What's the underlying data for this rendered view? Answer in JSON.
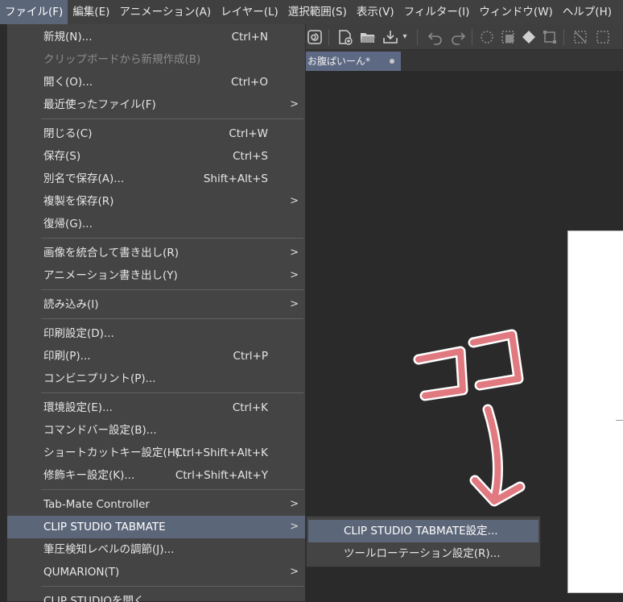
{
  "menubar": {
    "items": [
      {
        "label": "ファイル(F)"
      },
      {
        "label": "編集(E)"
      },
      {
        "label": "アニメーション(A)"
      },
      {
        "label": "レイヤー(L)"
      },
      {
        "label": "選択範囲(S)"
      },
      {
        "label": "表示(V)"
      },
      {
        "label": "フィルター(I)"
      },
      {
        "label": "ウィンドウ(W)"
      },
      {
        "label": "ヘルプ(H)"
      }
    ]
  },
  "document_tab": {
    "title": "お腹ぱいーん*"
  },
  "file_menu": {
    "items": [
      {
        "label": "新規(N)...",
        "shortcut": "Ctrl+N"
      },
      {
        "label": "クリップボードから新規作成(B)",
        "shortcut": ""
      },
      {
        "label": "開く(O)...",
        "shortcut": "Ctrl+O"
      },
      {
        "label": "最近使ったファイル(F)",
        "shortcut": ""
      },
      {
        "label": "閉じる(C)",
        "shortcut": "Ctrl+W"
      },
      {
        "label": "保存(S)",
        "shortcut": "Ctrl+S"
      },
      {
        "label": "別名で保存(A)...",
        "shortcut": "Shift+Alt+S"
      },
      {
        "label": "複製を保存(R)",
        "shortcut": ""
      },
      {
        "label": "復帰(G)...",
        "shortcut": ""
      },
      {
        "label": "画像を統合して書き出し(R)",
        "shortcut": ""
      },
      {
        "label": "アニメーション書き出し(Y)",
        "shortcut": ""
      },
      {
        "label": "読み込み(I)",
        "shortcut": ""
      },
      {
        "label": "印刷設定(D)...",
        "shortcut": ""
      },
      {
        "label": "印刷(P)...",
        "shortcut": "Ctrl+P"
      },
      {
        "label": "コンビニプリント(P)...",
        "shortcut": ""
      },
      {
        "label": "環境設定(E)...",
        "shortcut": "Ctrl+K"
      },
      {
        "label": "コマンドバー設定(B)...",
        "shortcut": ""
      },
      {
        "label": "ショートカットキー設定(H)...",
        "shortcut": "Ctrl+Shift+Alt+K"
      },
      {
        "label": "修飾キー設定(K)...",
        "shortcut": "Ctrl+Shift+Alt+Y"
      },
      {
        "label": "Tab-Mate Controller",
        "shortcut": ""
      },
      {
        "label": "CLIP STUDIO TABMATE",
        "shortcut": ""
      },
      {
        "label": "筆圧検知レベルの調節(J)...",
        "shortcut": ""
      },
      {
        "label": "QUMARION(T)",
        "shortcut": ""
      },
      {
        "label": "CLIP STUDIOを開く",
        "shortcut": ""
      }
    ]
  },
  "submenu": {
    "items": [
      {
        "label": "CLIP STUDIO TABMATE設定..."
      },
      {
        "label": "ツールローテーション設定(R)..."
      }
    ]
  },
  "annotation": {
    "text": "ココ",
    "color": "#e07a80"
  },
  "colors": {
    "highlight": "#5c6679",
    "menu_bg": "#444444",
    "menubar_bg": "#404040"
  }
}
